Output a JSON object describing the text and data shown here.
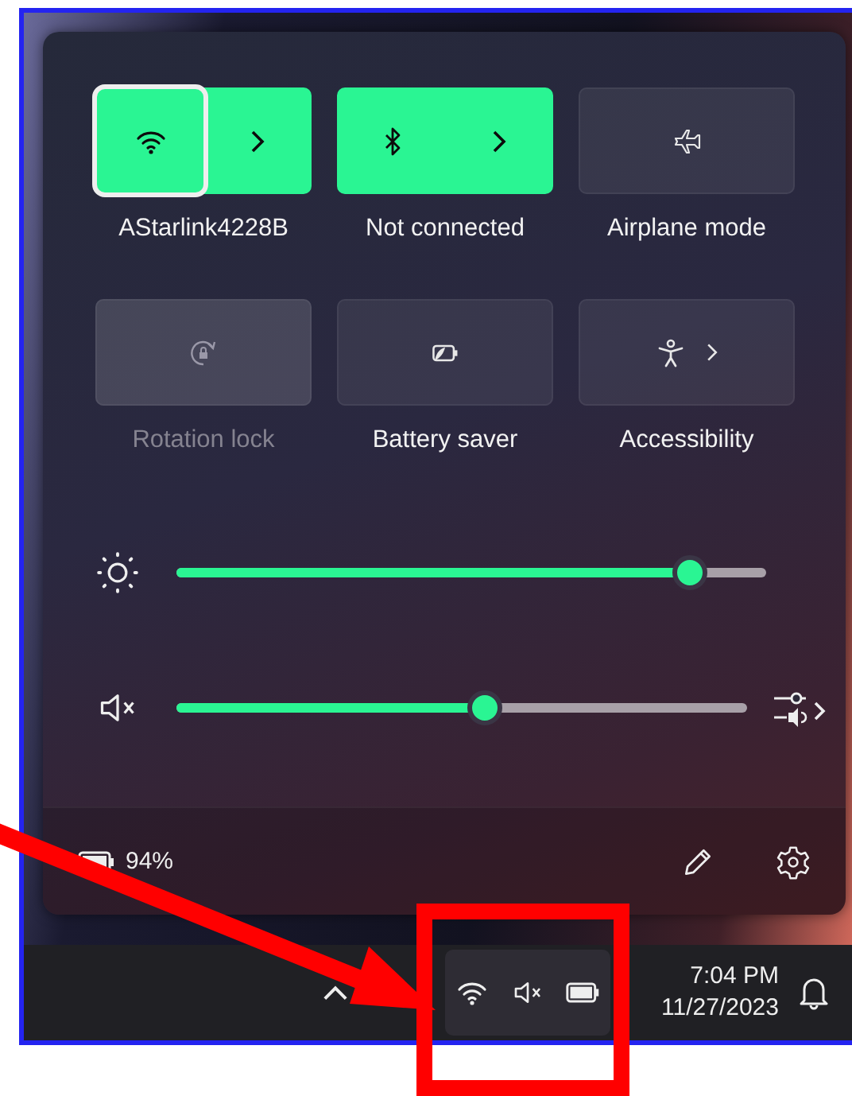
{
  "quick_settings": {
    "tiles": [
      {
        "label": "AStarlink4228B",
        "kind": "split",
        "on": true,
        "focused": true,
        "disabled": false
      },
      {
        "label": "Not connected",
        "kind": "split",
        "on": true,
        "focused": false,
        "disabled": false
      },
      {
        "label": "Airplane mode",
        "kind": "single",
        "on": false,
        "focused": false,
        "disabled": false
      },
      {
        "label": "Rotation lock",
        "kind": "single",
        "on": false,
        "focused": false,
        "disabled": true
      },
      {
        "label": "Battery saver",
        "kind": "single",
        "on": false,
        "focused": false,
        "disabled": false
      },
      {
        "label": "Accessibility",
        "kind": "chevron",
        "on": false,
        "focused": false,
        "disabled": false
      }
    ],
    "brightness": {
      "level": 0.87
    },
    "volume": {
      "level": 0.54,
      "muted": true
    },
    "battery": "94%"
  },
  "taskbar": {
    "time": "7:04 PM",
    "date": "11/27/2023"
  }
}
